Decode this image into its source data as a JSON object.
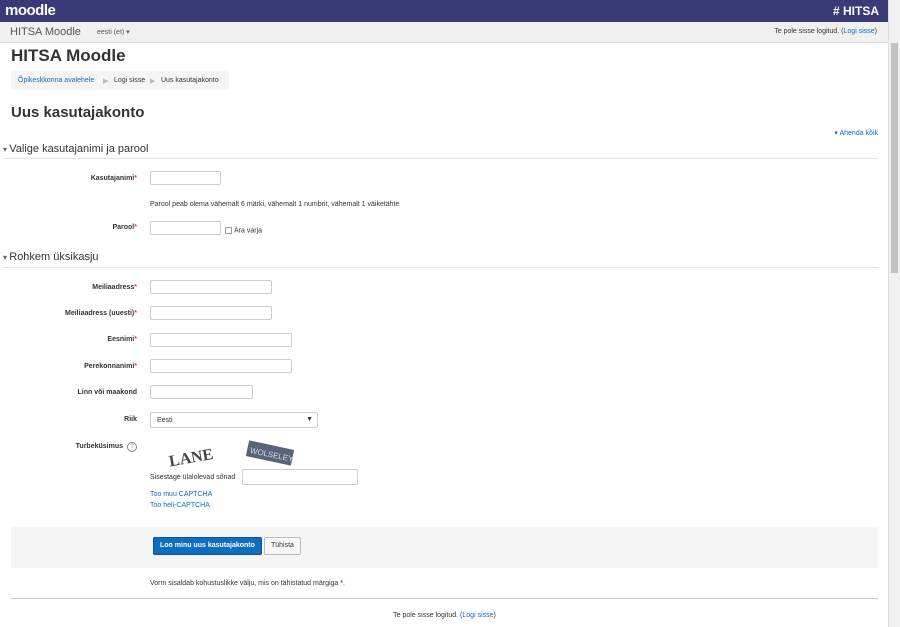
{
  "header": {
    "logo_text": "moodle",
    "brand": "# HITSA",
    "site_link": "HITSA Moodle",
    "language": "eesti (et) ▾",
    "login_prefix": "Te pole sisse logitud. (",
    "login_link": "Logi sisse",
    "login_suffix": ")"
  },
  "page": {
    "site_title": "HITSA Moodle",
    "breadcrumb": [
      "Õpikeskkonna avalehele",
      "Logi sisse",
      "Uus kasutajakonto"
    ],
    "title": "Uus kasutajakonto",
    "collapse_all": "Ahenda kõik"
  },
  "section1": {
    "title": "Valige kasutajanimi ja parool",
    "username_label": "Kasutajanimi",
    "password_hint": "Parool peab olema vähemalt 6 märki, vähemalt 1 numbrit, vähemalt 1 väiketähte",
    "password_label": "Parool",
    "unmask_label": "Ära varja"
  },
  "section2": {
    "title": "Rohkem üksikasju",
    "email_label": "Meiliaadress",
    "email2_label": "Meiliaadress (uuesti)",
    "firstname_label": "Eesnimi",
    "lastname_label": "Perekonnanimi",
    "city_label": "Linn või maakond",
    "country_label": "Riik",
    "country_value": "Eesti",
    "captcha_label": "Turbeküsimus",
    "captcha_word1": "LANE",
    "captcha_word2": "WOLSELEY",
    "captcha_input_label": "Sisestage ülalolevad sõnad",
    "captcha_other": "Too muu CAPTCHA",
    "captcha_audio": "Too heli-CAPTCHA"
  },
  "actions": {
    "submit": "Loo minu uus kasutajakonto",
    "cancel": "Tühista"
  },
  "required_note": "Vorm sisaldab kohustuslikke välju, mis on tähistatud märgiga",
  "required_mark": "*",
  "footer": {
    "login_prefix": "Te pole sisse logitud. (",
    "login_link": "Logi sisse",
    "login_suffix": ")"
  },
  "colors": {
    "topbar": "#3a3a77",
    "link": "#0f6cbf",
    "required": "#b94a48",
    "logo_accent": "#f98012"
  }
}
